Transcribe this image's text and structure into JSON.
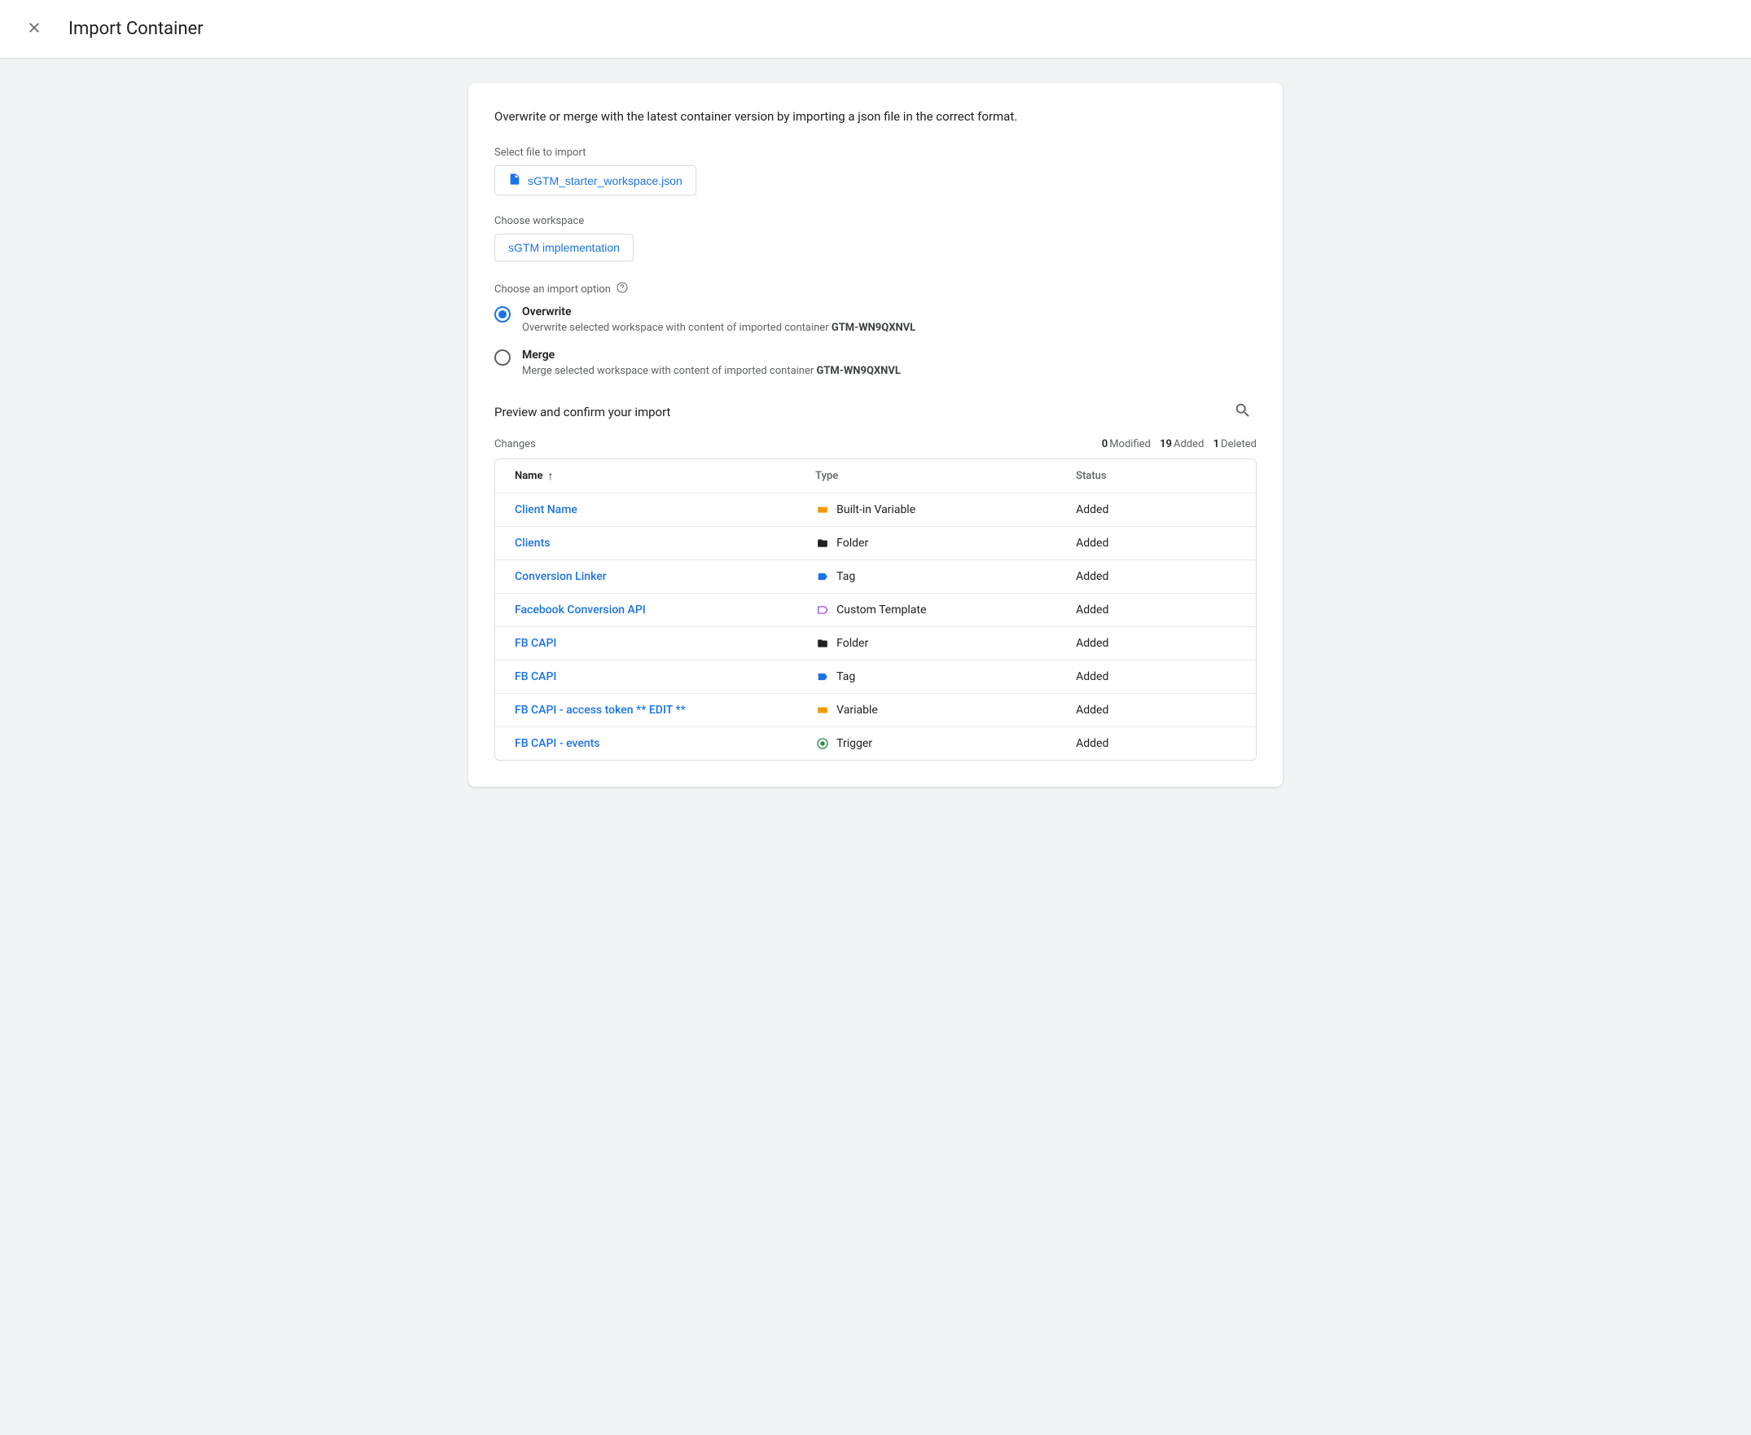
{
  "header": {
    "title": "Import Container"
  },
  "intro": "Overwrite or merge with the latest container version by importing a json file in the correct format.",
  "selectFile": {
    "label": "Select file to import",
    "filename": "sGTM_starter_workspace.json"
  },
  "workspace": {
    "label": "Choose workspace",
    "name": "sGTM implementation"
  },
  "importOption": {
    "label": "Choose an import option",
    "containerId": "GTM-WN9QXNVL",
    "overwrite": {
      "title": "Overwrite",
      "descPrefix": "Overwrite selected workspace with content of imported container "
    },
    "merge": {
      "title": "Merge",
      "descPrefix": "Merge selected workspace with content of imported container "
    }
  },
  "preview": {
    "title": "Preview and confirm your import",
    "changesLabel": "Changes",
    "summary": {
      "modified": "0",
      "modifiedLabel": "Modified",
      "added": "19",
      "addedLabel": "Added",
      "deleted": "1",
      "deletedLabel": "Deleted"
    }
  },
  "table": {
    "headers": {
      "name": "Name",
      "type": "Type",
      "status": "Status"
    },
    "rows": [
      {
        "name": "Client Name",
        "type": "Built-in Variable",
        "iconKind": "variable",
        "status": "Added"
      },
      {
        "name": "Clients",
        "type": "Folder",
        "iconKind": "folder",
        "status": "Added"
      },
      {
        "name": "Conversion Linker",
        "type": "Tag",
        "iconKind": "tag",
        "status": "Added"
      },
      {
        "name": "Facebook Conversion API",
        "type": "Custom Template",
        "iconKind": "template",
        "status": "Added"
      },
      {
        "name": "FB CAPI",
        "type": "Folder",
        "iconKind": "folder",
        "status": "Added"
      },
      {
        "name": "FB CAPI",
        "type": "Tag",
        "iconKind": "tag",
        "status": "Added"
      },
      {
        "name": "FB CAPI - access token ** EDIT **",
        "type": "Variable",
        "iconKind": "variable",
        "status": "Added"
      },
      {
        "name": "FB CAPI - events",
        "type": "Trigger",
        "iconKind": "trigger",
        "status": "Added"
      }
    ]
  }
}
